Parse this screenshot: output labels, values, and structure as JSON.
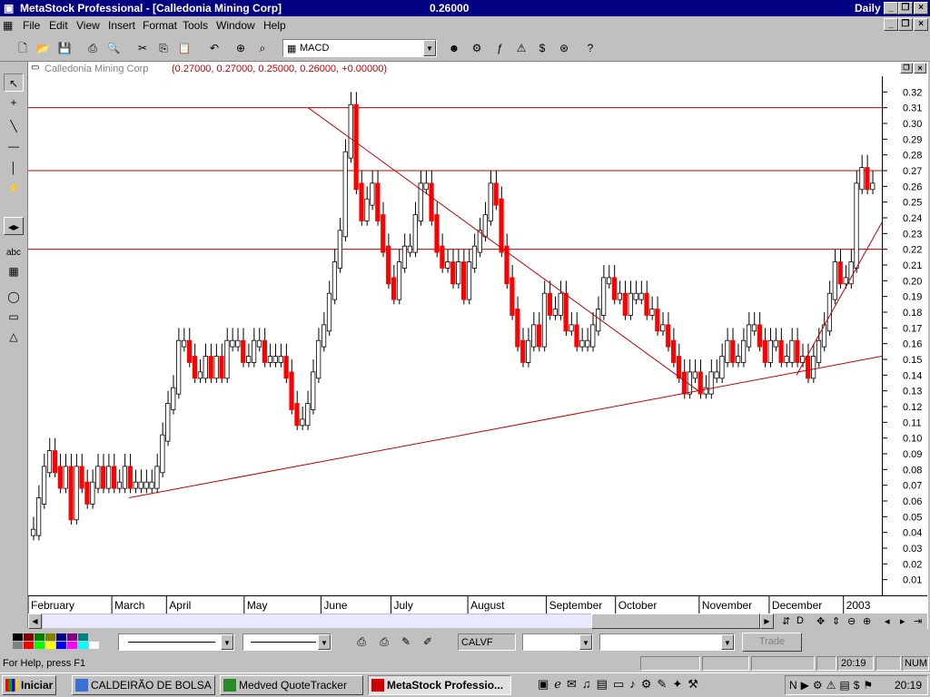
{
  "window": {
    "title": "MetaStock Professional - [Calledonia Mining Corp]",
    "price": "0.26000",
    "period": "Daily"
  },
  "menu": [
    "File",
    "Edit",
    "View",
    "Insert",
    "Format",
    "Tools",
    "Window",
    "Help"
  ],
  "toolbar": {
    "indicator_value": "MACD"
  },
  "chart": {
    "security": "Calledonia Mining Corp",
    "ohlc": "(0.27000, 0.27000, 0.25000, 0.26000, +0.00000)"
  },
  "chart_data": {
    "type": "bar",
    "title": "Calledonia Mining Corp",
    "ylim": [
      0.0,
      0.33
    ],
    "yticks": [
      0.01,
      0.02,
      0.03,
      0.04,
      0.05,
      0.06,
      0.07,
      0.08,
      0.09,
      0.1,
      0.11,
      0.12,
      0.13,
      0.14,
      0.15,
      0.16,
      0.17,
      0.18,
      0.19,
      0.2,
      0.21,
      0.22,
      0.23,
      0.24,
      0.25,
      0.26,
      0.27,
      0.28,
      0.29,
      0.3,
      0.31,
      0.32
    ],
    "months": [
      "February",
      "March",
      "April",
      "May",
      "June",
      "July",
      "August",
      "September",
      "October",
      "November",
      "December",
      "2003"
    ],
    "horizontal_lines": [
      0.31,
      0.27,
      0.22
    ],
    "trendlines": [
      {
        "from": [
          0.118,
          0.062
        ],
        "to": [
          1.0,
          0.152
        ]
      },
      {
        "from": [
          0.328,
          0.31
        ],
        "to": [
          0.785,
          0.13
        ]
      },
      {
        "from": [
          0.9,
          0.14
        ],
        "to": [
          1.0,
          0.237
        ]
      }
    ],
    "series": [
      {
        "values": [
          0.04,
          0.06,
          0.08,
          0.09,
          0.08,
          0.07,
          0.08,
          0.05,
          0.08,
          0.07,
          0.06,
          0.07,
          0.08,
          0.07,
          0.08,
          0.07,
          0.07,
          0.08,
          0.07,
          0.07,
          0.07,
          0.07,
          0.07,
          0.08,
          0.1,
          0.12,
          0.13,
          0.16,
          0.16,
          0.15,
          0.14,
          0.14,
          0.15,
          0.14,
          0.15,
          0.14,
          0.16,
          0.16,
          0.16,
          0.15,
          0.15,
          0.16,
          0.16,
          0.15,
          0.15,
          0.15,
          0.15,
          0.14,
          0.12,
          0.11,
          0.11,
          0.12,
          0.14,
          0.16,
          0.17,
          0.19,
          0.21,
          0.23,
          0.28,
          0.31,
          0.26,
          0.24,
          0.25,
          0.26,
          0.24,
          0.22,
          0.2,
          0.19,
          0.21,
          0.22,
          0.22,
          0.24,
          0.26,
          0.26,
          0.24,
          0.22,
          0.21,
          0.21,
          0.2,
          0.21,
          0.19,
          0.21,
          0.22,
          0.23,
          0.24,
          0.26,
          0.25,
          0.22,
          0.2,
          0.18,
          0.16,
          0.15,
          0.16,
          0.17,
          0.16,
          0.19,
          0.18,
          0.18,
          0.19,
          0.17,
          0.17,
          0.16,
          0.16,
          0.16,
          0.17,
          0.18,
          0.2,
          0.2,
          0.19,
          0.19,
          0.18,
          0.19,
          0.19,
          0.19,
          0.18,
          0.18,
          0.17,
          0.17,
          0.16,
          0.15,
          0.14,
          0.13,
          0.14,
          0.14,
          0.13,
          0.13,
          0.14,
          0.14,
          0.15,
          0.16,
          0.15,
          0.15,
          0.16,
          0.17,
          0.17,
          0.16,
          0.15,
          0.16,
          0.16,
          0.15,
          0.15,
          0.16,
          0.15,
          0.15,
          0.14,
          0.15,
          0.16,
          0.17,
          0.19,
          0.21,
          0.2,
          0.2,
          0.21,
          0.26,
          0.27,
          0.26,
          0.26
        ]
      }
    ]
  },
  "bottom": {
    "symbol": "CALVF",
    "trade_label": "Trade"
  },
  "status": {
    "help": "For Help, press F1",
    "time": "20:19",
    "num": "NUM"
  },
  "taskbar": {
    "start": "Iniciar",
    "tasks": [
      "CALDEIRÃO DE BOLSA ...",
      "Medved QuoteTracker",
      "MetaStock Professio..."
    ],
    "clock": "20:19"
  }
}
